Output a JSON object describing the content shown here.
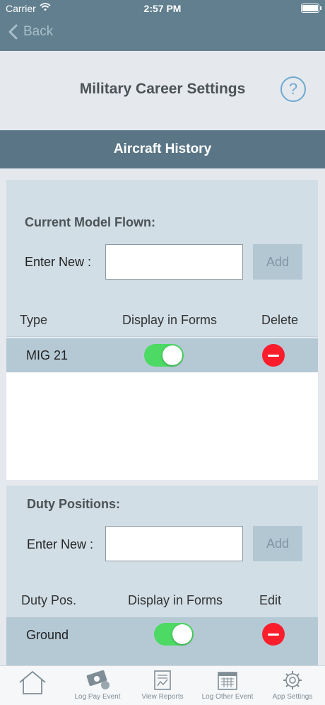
{
  "status": {
    "carrier": "Carrier",
    "time": "2:57 PM"
  },
  "nav": {
    "back_label": "Back"
  },
  "page": {
    "title": "Military Career Settings",
    "help_symbol": "?"
  },
  "aircraft": {
    "header": "Aircraft History",
    "label": "Current Model Flown:",
    "enter_label": "Enter New :",
    "input_value": "",
    "add_label": "Add",
    "columns": [
      "Type",
      "Display in Forms",
      "Delete"
    ],
    "rows": [
      {
        "type": "MIG 21",
        "display_in_forms": true
      }
    ]
  },
  "duty": {
    "label": "Duty Positions:",
    "enter_label": "Enter New :",
    "input_value": "",
    "add_label": "Add",
    "columns": [
      "Duty Pos.",
      "Display in Forms",
      "Edit"
    ],
    "rows": [
      {
        "position": "Ground",
        "display_in_forms": true
      }
    ]
  },
  "tabbar": {
    "items": [
      {
        "label": "",
        "icon": "home-icon"
      },
      {
        "label": "Log Pay Event",
        "icon": "money-icon"
      },
      {
        "label": "View Reports",
        "icon": "report-icon"
      },
      {
        "label": "Log Other Event",
        "icon": "calendar-icon"
      },
      {
        "label": "App Settings",
        "icon": "gear-icon"
      }
    ]
  },
  "colors": {
    "bar": "#617f8f",
    "section": "#5a7686",
    "toggle_on": "#4cd964",
    "delete": "#fa1e2d",
    "help": "#6fa8cf"
  }
}
